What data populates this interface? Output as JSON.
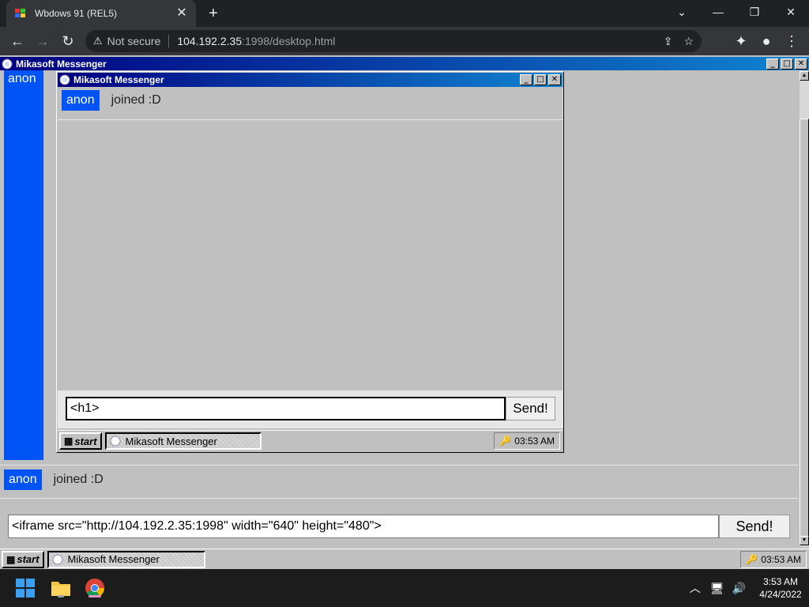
{
  "browser": {
    "tab_title": "Wbdows 91 (REL5)",
    "tab_close": "✕",
    "new_tab": "+",
    "win_minimize": "—",
    "win_maximize": "❐",
    "win_close": "✕",
    "back": "←",
    "forward": "→",
    "reload": "↻",
    "security_label": "Not secure",
    "url_host": "104.192.2.35",
    "url_path": ":1998/desktop.html"
  },
  "outer_window": {
    "title": "Mikasoft Messenger",
    "minimize": "_",
    "maximize": "□",
    "close": "✕",
    "sidebar_user": "anon",
    "messages": [
      {
        "user": "anon",
        "text": "joined :D"
      }
    ],
    "input_value": "<iframe src=\"http://104.192.2.35:1998\" width=\"640\" height=\"480\">",
    "send_label": "Send!",
    "scroll_up": "▲",
    "scroll_down": "▼"
  },
  "inner_window": {
    "title": "Mikasoft Messenger",
    "minimize": "_",
    "maximize": "□",
    "close": "✕",
    "messages": [
      {
        "user": "anon",
        "text": "joined :D"
      }
    ],
    "input_value": "<h1>",
    "send_label": "Send!"
  },
  "inner_taskbar": {
    "start_label": "start",
    "task_label": "Mikasoft Messenger",
    "clock": "03:53 AM"
  },
  "outer_taskbar": {
    "start_label": "start",
    "task_label": "Mikasoft Messenger",
    "clock": "03:53 AM"
  },
  "windows_taskbar": {
    "time": "3:53 AM",
    "date": "4/24/2022"
  },
  "colors": {
    "win95_blue": "#0053f5",
    "titlebar_start": "#000080",
    "titlebar_end": "#1084d0"
  }
}
